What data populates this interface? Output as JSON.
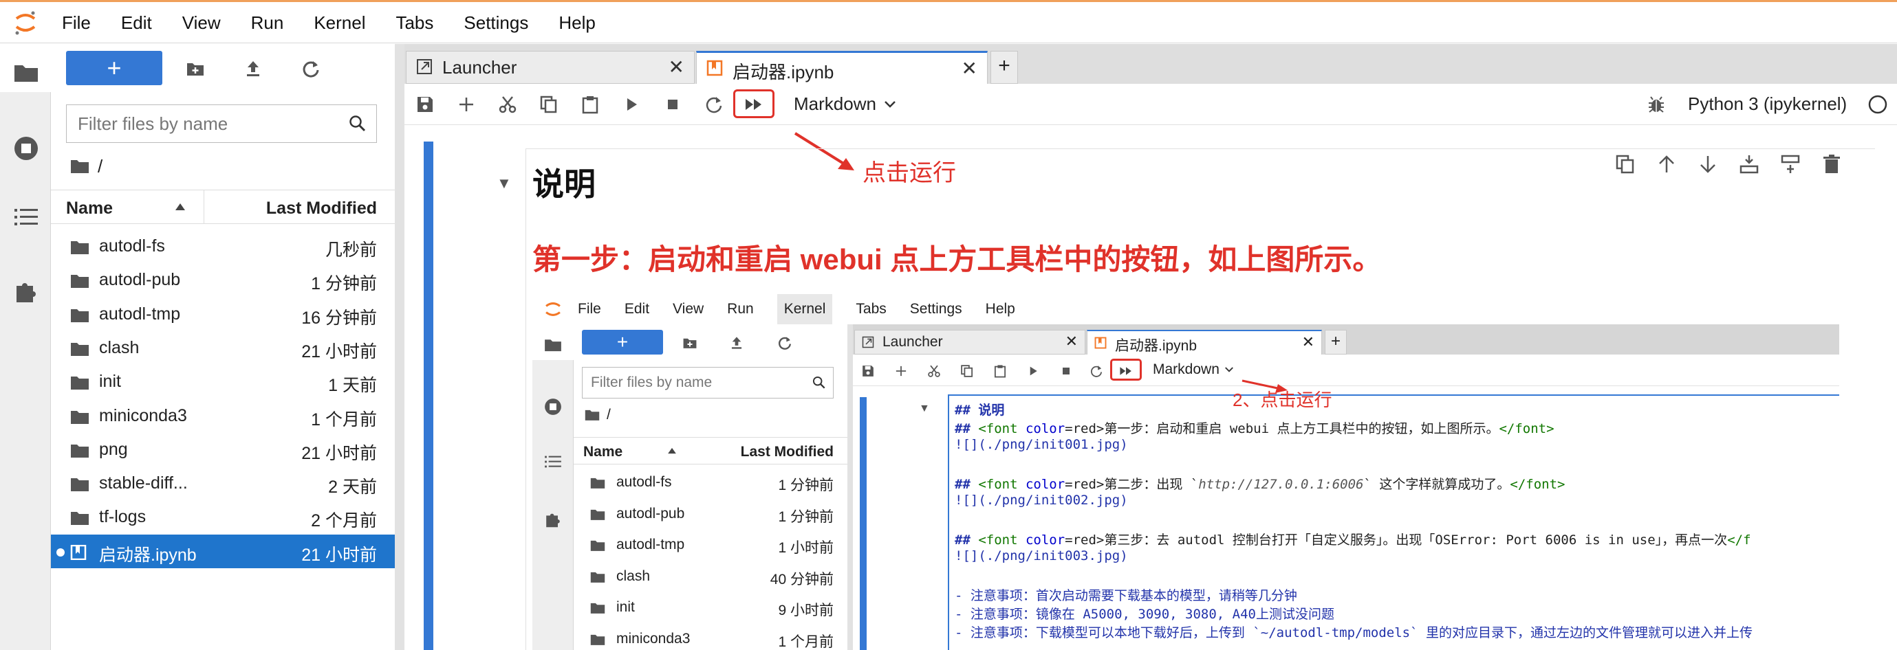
{
  "menubar": {
    "items": [
      "File",
      "Edit",
      "View",
      "Run",
      "Kernel",
      "Tabs",
      "Settings",
      "Help"
    ]
  },
  "filebrowser": {
    "new_label": "+",
    "filter_placeholder": "Filter files by name",
    "breadcrumb": "/",
    "col_name": "Name",
    "col_modified": "Last Modified",
    "rows": [
      {
        "name": "autodl-fs",
        "modified": "几秒前"
      },
      {
        "name": "autodl-pub",
        "modified": "1 分钟前"
      },
      {
        "name": "autodl-tmp",
        "modified": "16 分钟前"
      },
      {
        "name": "clash",
        "modified": "21 小时前"
      },
      {
        "name": "init",
        "modified": "1 天前"
      },
      {
        "name": "miniconda3",
        "modified": "1 个月前"
      },
      {
        "name": "png",
        "modified": "21 小时前"
      },
      {
        "name": "stable-diff...",
        "modified": "2 天前"
      },
      {
        "name": "tf-logs",
        "modified": "2 个月前"
      },
      {
        "name": "启动器.ipynb",
        "modified": "21 小时前"
      }
    ]
  },
  "tabs": [
    {
      "label": "Launcher"
    },
    {
      "label": "启动器.ipynb"
    }
  ],
  "tab_add": "+",
  "toolbar": {
    "cell_type": "Markdown",
    "kernel": "Python 3 (ipykernel)"
  },
  "annotations": {
    "run_hint": "点击运行",
    "run_hint2": "2、点击运行"
  },
  "notebook": {
    "title": "说明",
    "step1": "第一步：启动和重启 webui 点上方工具栏中的按钮，如上图所示。"
  },
  "embedded": {
    "menubar": [
      "File",
      "Edit",
      "View",
      "Run",
      "Kernel",
      "Tabs",
      "Settings",
      "Help"
    ],
    "new_label": "+",
    "filter_placeholder": "Filter files by name",
    "breadcrumb": "/",
    "col_name": "Name",
    "col_modified": "Last Modified",
    "rows": [
      {
        "name": "autodl-fs",
        "modified": "1 分钟前"
      },
      {
        "name": "autodl-pub",
        "modified": "1 分钟前"
      },
      {
        "name": "autodl-tmp",
        "modified": "1 小时前"
      },
      {
        "name": "clash",
        "modified": "40 分钟前"
      },
      {
        "name": "init",
        "modified": "9 小时前"
      },
      {
        "name": "miniconda3",
        "modified": "1 个月前"
      }
    ],
    "tabs": [
      {
        "label": "Launcher"
      },
      {
        "label": "启动器.ipynb"
      }
    ],
    "cell_type": "Markdown",
    "code": {
      "l1_h": "## 说明",
      "l2_a": "## ",
      "l2_tag1": "<font ",
      "l2_attr": "color",
      "l2_eq": "=red>",
      "l2_text": "第一步：启动和重启 webui 点上方工具栏中的按钮，如上图所示。",
      "l2_tag2": "</font>",
      "l3": "![](./png/init001.jpg)",
      "l4_a": "## ",
      "l4_tag1": "<font ",
      "l4_attr": "color",
      "l4_eq": "=red>",
      "l4_text1": "第二步：出现 `",
      "l4_it": "http://127.0.0.1:6006",
      "l4_text2": "` 这个字样就算成功了。",
      "l4_tag2": "</font>",
      "l5": "![](./png/init002.jpg)",
      "l6_a": "## ",
      "l6_tag1": "<font ",
      "l6_attr": "color",
      "l6_eq": "=red>",
      "l6_text": "第三步：去 autodl 控制台打开「自定义服务」。出现「OSError: Port 6006 is in use」，再点一次",
      "l6_tag2": "</f",
      "l7": "![](./png/init003.jpg)",
      "l8": "- 注意事项：首次启动需要下载基本的模型，请稍等几分钟",
      "l9": "- 注意事项：镜像在 A5000, 3090, 3080, A40上测试没问题",
      "l10": "- 注意事项：下载模型可以本地下载好后，上传到 `~/autodl-tmp/models` 里的对应目录下，通过左边的文件管理就可以进入并上传"
    }
  },
  "colors": {
    "accent": "#3478d4",
    "annotation": "#e0322a",
    "selection": "#1f75cc"
  }
}
